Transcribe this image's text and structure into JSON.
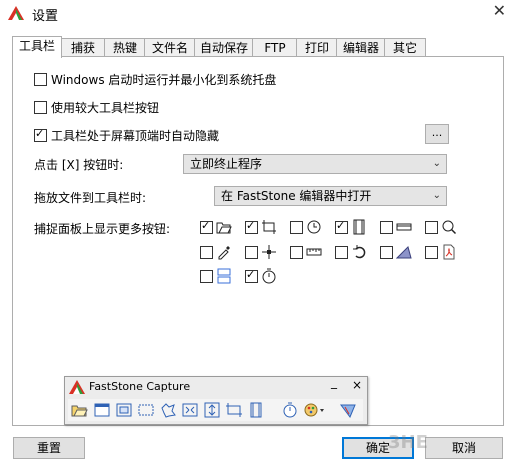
{
  "window": {
    "title": "设置"
  },
  "tabs": [
    "工具栏",
    "捕获",
    "热键",
    "文件名",
    "自动保存",
    "FTP",
    "打印",
    "编辑器",
    "其它"
  ],
  "options": {
    "startup_tray": {
      "label": "Windows 启动时运行并最小化到系统托盘",
      "checked": false
    },
    "large_buttons": {
      "label": "使用较大工具栏按钮",
      "checked": false
    },
    "auto_hide": {
      "label": "工具栏处于屏幕顶端时自动隐藏",
      "checked": true
    },
    "dots_label": "..."
  },
  "close_action": {
    "label": "点击 [X] 按钮时:",
    "value": "立即终止程序"
  },
  "drop_action": {
    "label": "拖放文件到工具栏时:",
    "value": "在 FastStone 编辑器中打开"
  },
  "more_buttons": {
    "label": "捕捉面板上显示更多按钮:",
    "items": [
      {
        "icon": "open-folder-icon",
        "checked": true
      },
      {
        "icon": "crop-region-icon",
        "checked": true
      },
      {
        "icon": "clock-delay-icon",
        "checked": false
      },
      {
        "icon": "film-icon",
        "checked": true
      },
      {
        "icon": "window-bar-icon",
        "checked": false
      },
      {
        "icon": "magnifier-icon",
        "checked": false
      },
      {
        "icon": "eyedropper-icon",
        "checked": false
      },
      {
        "icon": "crosshair-icon",
        "checked": false
      },
      {
        "icon": "ruler-icon",
        "checked": false
      },
      {
        "icon": "undo-arrow-icon",
        "checked": false
      },
      {
        "icon": "triangle-tool-icon",
        "checked": false
      },
      {
        "icon": "pdf-icon",
        "checked": false
      },
      {
        "icon": "split-panel-icon",
        "checked": false
      },
      {
        "icon": "stopwatch-icon",
        "checked": true
      }
    ]
  },
  "toolbar_preview": {
    "title": "FastStone Capture",
    "minimize": "_",
    "close": "×",
    "buttons": [
      "open-icon",
      "capture-window-icon",
      "capture-object-icon",
      "capture-rect-icon",
      "capture-freehand-icon",
      "capture-fullscreen-icon",
      "capture-scroll-icon",
      "capture-fixed-icon",
      "capture-video-icon",
      "delay-timer-icon",
      "output-palette-icon",
      "settings-icon"
    ]
  },
  "footer": {
    "reset": "重置",
    "ok": "确定",
    "cancel": "取消"
  },
  "watermark": "3HE",
  "colors": {
    "accent": "#0078d7",
    "app_red": "#d93025",
    "app_green": "#2e9e3b"
  }
}
